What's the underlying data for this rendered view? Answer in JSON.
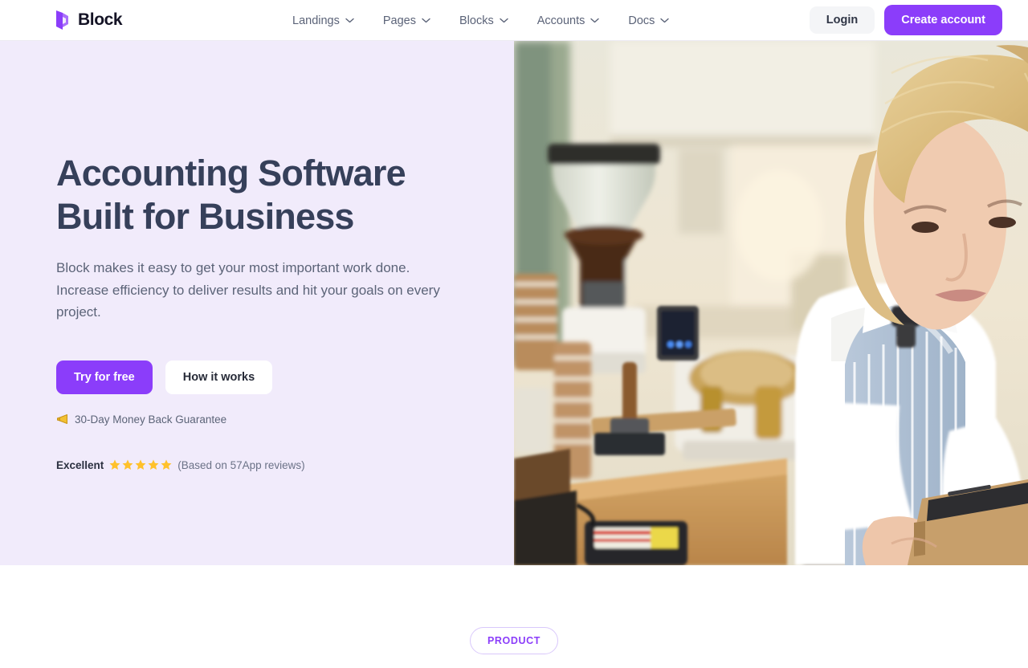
{
  "theme": {
    "accent": "#8b3dfa",
    "hero_bg": "#f1ebfb",
    "heading_color": "#36405a",
    "body_text": "#5c6478",
    "star_color": "#ffc12b",
    "header_bg": "#ffffff"
  },
  "header": {
    "brand": {
      "name": "Block",
      "logo_icon": "block-logo-icon"
    },
    "nav": [
      {
        "label": "Landings",
        "icon": "chevron-down-icon"
      },
      {
        "label": "Pages",
        "icon": "chevron-down-icon"
      },
      {
        "label": "Blocks",
        "icon": "chevron-down-icon"
      },
      {
        "label": "Accounts",
        "icon": "chevron-down-icon"
      },
      {
        "label": "Docs",
        "icon": "chevron-down-icon"
      }
    ],
    "login_label": "Login",
    "create_account_label": "Create account"
  },
  "hero": {
    "title_line1": "Accounting Software",
    "title_line2": "Built for Business",
    "subtitle": "Block makes it easy to get your most important work done. Increase efficiency to deliver results and hit your goals on every project.",
    "primary_cta": "Try for free",
    "secondary_cta": "How it works",
    "guarantee": {
      "icon": "megaphone-icon",
      "text": "30-Day Money Back Guarantee"
    },
    "reviews": {
      "label": "Excellent",
      "rating": 5,
      "max_rating": 5,
      "star_icon": "star-icon",
      "count_text": "(Based on 57App reviews)"
    },
    "image": {
      "icon": "barista-photo",
      "alt": "Barista using a tablet behind a cafe counter"
    }
  },
  "below_hero": {
    "badge_label": "PRODUCT"
  }
}
